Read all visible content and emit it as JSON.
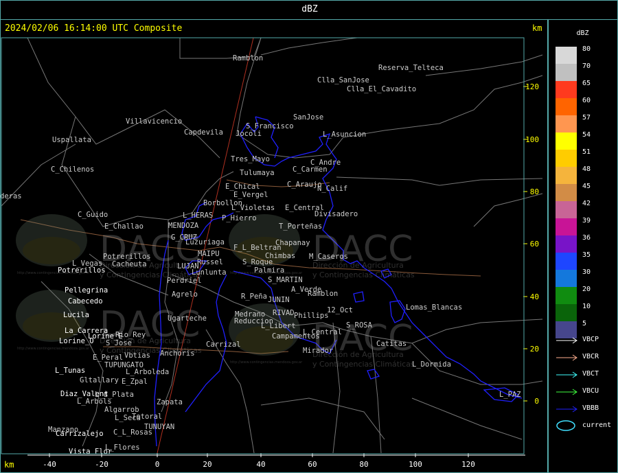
{
  "title": "dBZ",
  "timestamp": "2024/02/06 16:14:00 UTC Composite",
  "km_unit": "km",
  "x_ticks": [
    "-40",
    "-20",
    "0",
    "20",
    "40",
    "60",
    "80",
    "100",
    "120"
  ],
  "y_ticks": [
    "120",
    "100",
    "80",
    "60",
    "40",
    "20",
    "0"
  ],
  "legend": {
    "title": "dBZ",
    "scale": [
      {
        "label": "80",
        "color": "#d8d8d8"
      },
      {
        "label": "70",
        "color": "#c0c0c0"
      },
      {
        "label": "65",
        "color": "#ff3a1e"
      },
      {
        "label": "60",
        "color": "#ff6400"
      },
      {
        "label": "57",
        "color": "#ff9650"
      },
      {
        "label": "54",
        "color": "#ffff00"
      },
      {
        "label": "51",
        "color": "#ffcc00"
      },
      {
        "label": "48",
        "color": "#f5b43c"
      },
      {
        "label": "45",
        "color": "#d28c46"
      },
      {
        "label": "42",
        "color": "#c86496"
      },
      {
        "label": "39",
        "color": "#c81496"
      },
      {
        "label": "36",
        "color": "#7814c8"
      },
      {
        "label": "35",
        "color": "#1e46ff"
      },
      {
        "label": "30",
        "color": "#1478dc"
      },
      {
        "label": "20",
        "color": "#108c10"
      },
      {
        "label": "10",
        "color": "#0a640a"
      },
      {
        "label": "5",
        "color": "#46468c"
      }
    ],
    "lines": [
      {
        "label": "VBCP",
        "color": "#ffffff",
        "icon": "arrow-icon"
      },
      {
        "label": "VBCR",
        "color": "#ffb090",
        "icon": "arrow-icon"
      },
      {
        "label": "VBCT",
        "color": "#40ffff",
        "icon": "arrow-icon"
      },
      {
        "label": "VBCU",
        "color": "#40ff40",
        "icon": "arrow-icon"
      },
      {
        "label": "VBBB",
        "color": "#2020ff",
        "icon": "arrow-icon"
      }
    ],
    "current_label": "current",
    "current_color": "#40e0ff"
  },
  "watermark": {
    "brand": "DACC",
    "line1": "Dirección de Agricultura",
    "line2": "y Contingencias Climáticas",
    "url": "http://www.contingencias.mendoza.gov.ar"
  },
  "places_gray": [
    "Ramblon",
    "Reserva_Telteca",
    "Clla_SanJose",
    "Clla_El_Cavadito",
    "Villavicencio",
    "Capdevila",
    "SanJose",
    "S_Francisco",
    "Jocoli",
    "L_Asuncion",
    "Uspallata",
    "Tres_Mayo",
    "C_Andre",
    "C_Carmen",
    "Tulumaya",
    "C_Chilenos",
    "E_Chical",
    "C_Araujo",
    "N_Calif",
    "E_Vergel",
    "Borbollon",
    "deras",
    "L_Violetas",
    "E_Central",
    "Divisadero",
    "C_Guido",
    "L_HERAS",
    "P_Hierro",
    "E_Challao",
    "MENDOZA",
    "T_Porteñas",
    "G_CRUZ",
    "Luzuriaga",
    "F_L_Beltran",
    "Chapanay",
    "MAIPU",
    "Chimbas",
    "M_Caseros",
    "Potrerillos",
    "L_Vegas",
    "Cacheuta",
    "LUJAN",
    "Russel",
    "S_Roque",
    "Lunlunta",
    "Palmira",
    "Perdriel",
    "S_MARTIN",
    "A_Verde",
    "Agrelo",
    "R_Peña",
    "JUNIN",
    "Ramblon",
    "Lomas_Blancas",
    "Medrano",
    "RIVAD",
    "12_Oct",
    "Ugarteche",
    "Reduccion",
    "Phillips",
    "S_ROSA",
    "L_Libert",
    "Campamentos",
    "L_Central",
    "Rio_Rey",
    "Carrizal",
    "S_Jose",
    "Catitas",
    "Anchoris",
    "Mirador",
    "E_Peral",
    "Vbtias",
    "L_Dormida",
    "TUPUNGATO",
    "L_Arboleda",
    "Gltallary",
    "E_Zpal",
    "L_PAZ",
    "L_d_Plata",
    "L_Arbols",
    "Zapata",
    "Algarrob",
    "L_Seca",
    "Totoral",
    "Manzano",
    "TUNUYAN",
    "C_L_Rosas",
    "L_Flores"
  ],
  "places_white": [
    "Potrerillos",
    "Pellegrina",
    "Cabecedo",
    "Lucila",
    "La_Carrera",
    "Lorine_E",
    "Lorine_O",
    "L_Tunas",
    "Diaz_Valent",
    "Carrizalejo",
    "Vista_Flor"
  ]
}
